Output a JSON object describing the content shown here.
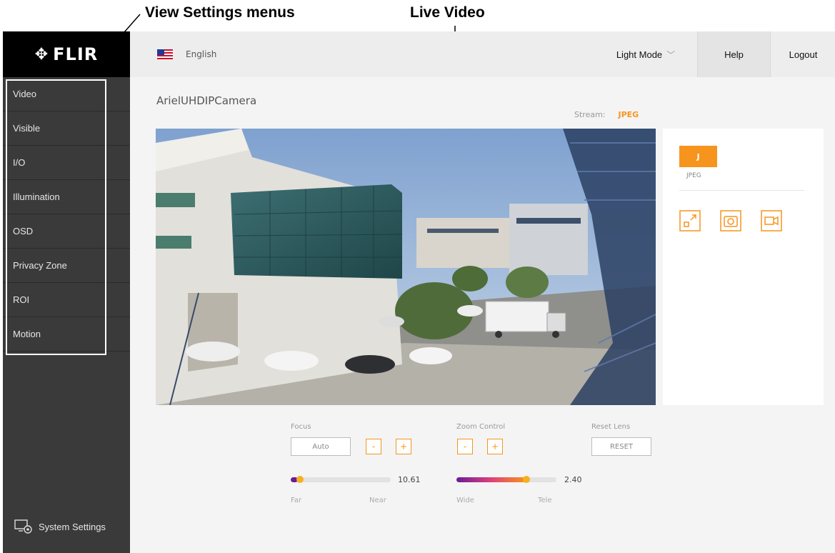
{
  "annotations": {
    "view_settings": "View Settings menus",
    "live_video": "Live Video"
  },
  "logo": {
    "text": "FLIR",
    "icon": "flir-diamond-icon"
  },
  "sidebar": {
    "items": [
      {
        "label": "Video"
      },
      {
        "label": "Visible"
      },
      {
        "label": "I/O"
      },
      {
        "label": "Illumination"
      },
      {
        "label": "OSD"
      },
      {
        "label": "Privacy Zone"
      },
      {
        "label": "ROI"
      },
      {
        "label": "Motion"
      }
    ],
    "system_settings": "System Settings"
  },
  "topbar": {
    "language": "English",
    "mode": "Light Mode",
    "help": "Help",
    "logout": "Logout"
  },
  "camera": {
    "name": "ArielUHDIPCamera",
    "stream_label": "Stream:",
    "stream_value": "JPEG"
  },
  "panel": {
    "stream_button": "J",
    "stream_label": "JPEG",
    "icons": [
      "fullscreen-icon",
      "snapshot-icon",
      "record-icon"
    ]
  },
  "controls": {
    "focus": {
      "label": "Focus",
      "auto": "Auto",
      "minus": "-",
      "plus": "+",
      "value": "10.61",
      "far": "Far",
      "near": "Near"
    },
    "zoom": {
      "label": "Zoom Control",
      "minus": "-",
      "plus": "+",
      "value": "2.40",
      "wide": "Wide",
      "tele": "Tele"
    },
    "reset": {
      "label": "Reset Lens",
      "button": "RESET"
    }
  },
  "colors": {
    "accent": "#f7941d",
    "sidebar": "#3a3a3a",
    "topbar": "#ededed"
  }
}
